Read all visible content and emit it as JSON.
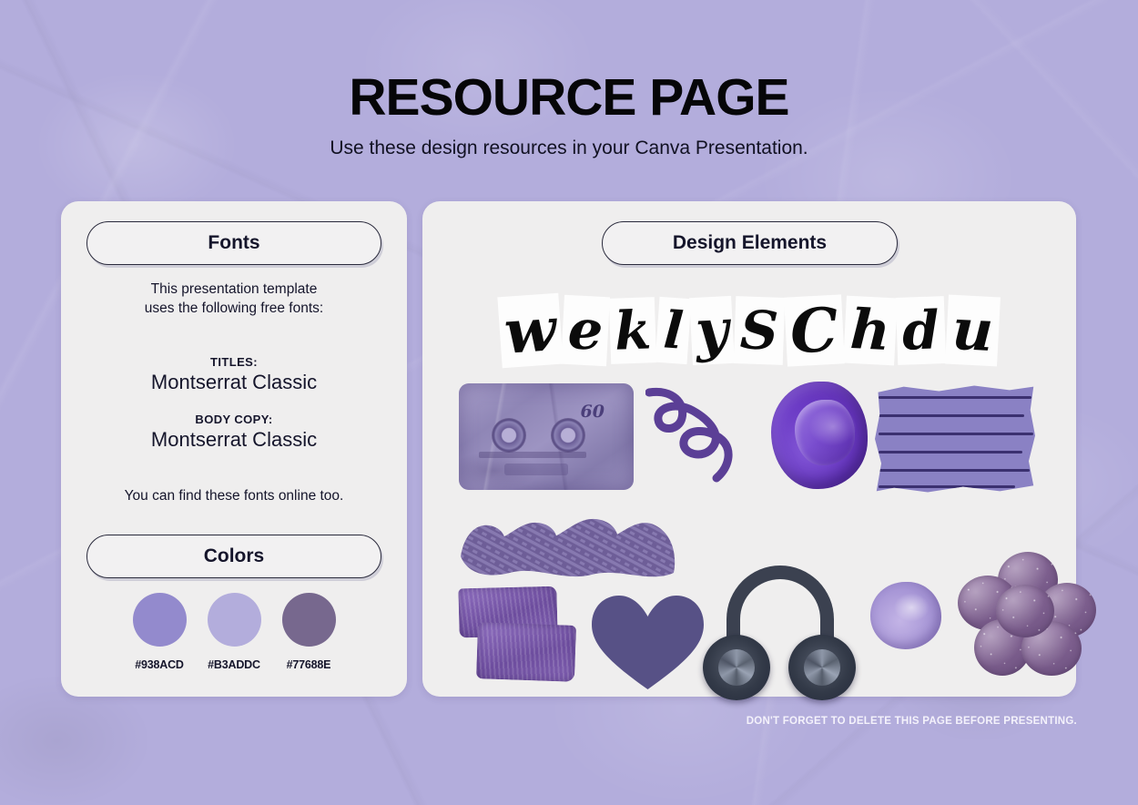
{
  "header": {
    "title": "RESOURCE PAGE",
    "subtitle": "Use these design resources in your Canva Presentation."
  },
  "fonts_card": {
    "pill_label": "Fonts",
    "intro": "This presentation template\nuses the following free fonts:",
    "titles_label": "TITLES:",
    "titles_value": "Montserrat Classic",
    "body_label": "BODY COPY:",
    "body_value": "Montserrat Classic",
    "outro": "You can find these fonts online too."
  },
  "colors_card": {
    "pill_label": "Colors",
    "swatches": [
      {
        "hex": "#938ACD",
        "label": "#938ACD"
      },
      {
        "hex": "#B3ADDC",
        "label": "#B3ADDC"
      },
      {
        "hex": "#77688E",
        "label": "#77688E"
      }
    ]
  },
  "elements_card": {
    "pill_label": "Design Elements",
    "ransom_letters": [
      {
        "char": "w",
        "size": 66,
        "rotate": -4,
        "pad": "6px 5px"
      },
      {
        "char": "e",
        "size": 60,
        "rotate": 3,
        "pad": "8px 6px"
      },
      {
        "char": "k",
        "size": 58,
        "rotate": -2,
        "pad": "7px 5px"
      },
      {
        "char": "l",
        "size": 56,
        "rotate": 4,
        "pad": "8px 7px"
      },
      {
        "char": "y",
        "size": 62,
        "rotate": -3,
        "pad": "6px 5px"
      },
      {
        "char": "S",
        "size": 58,
        "rotate": 2,
        "pad": "8px 6px"
      },
      {
        "char": "C",
        "size": 66,
        "rotate": -3,
        "pad": "5px 5px"
      },
      {
        "char": "h",
        "size": 60,
        "rotate": 3,
        "pad": "7px 6px"
      },
      {
        "char": "d",
        "size": 58,
        "rotate": -2,
        "pad": "8px 6px"
      },
      {
        "char": "u",
        "size": 62,
        "rotate": 3,
        "pad": "7px 6px"
      }
    ],
    "graphics": [
      {
        "name": "cassette-tape-graphic",
        "label": "60"
      },
      {
        "name": "squiggle-line-graphic",
        "label": ""
      },
      {
        "name": "paint-blob-graphic",
        "label": ""
      },
      {
        "name": "handwritten-note-scrap-graphic",
        "label": ""
      },
      {
        "name": "wave-shape-graphic",
        "label": ""
      },
      {
        "name": "brushstroke-graphic",
        "label": ""
      },
      {
        "name": "heart-shape-graphic",
        "label": ""
      },
      {
        "name": "headphones-graphic",
        "label": ""
      },
      {
        "name": "paint-dab-circle-graphic",
        "label": ""
      },
      {
        "name": "glitter-flower-graphic",
        "label": ""
      }
    ]
  },
  "footer": {
    "note": "DON'T FORGET TO DELETE THIS PAGE BEFORE PRESENTING."
  },
  "theme": {
    "background": "#B3ADDC",
    "card_background": "#EFEEEE",
    "ink": "#15152B",
    "accent_purple": "#6A39C4",
    "heart_purple": "#575186"
  }
}
